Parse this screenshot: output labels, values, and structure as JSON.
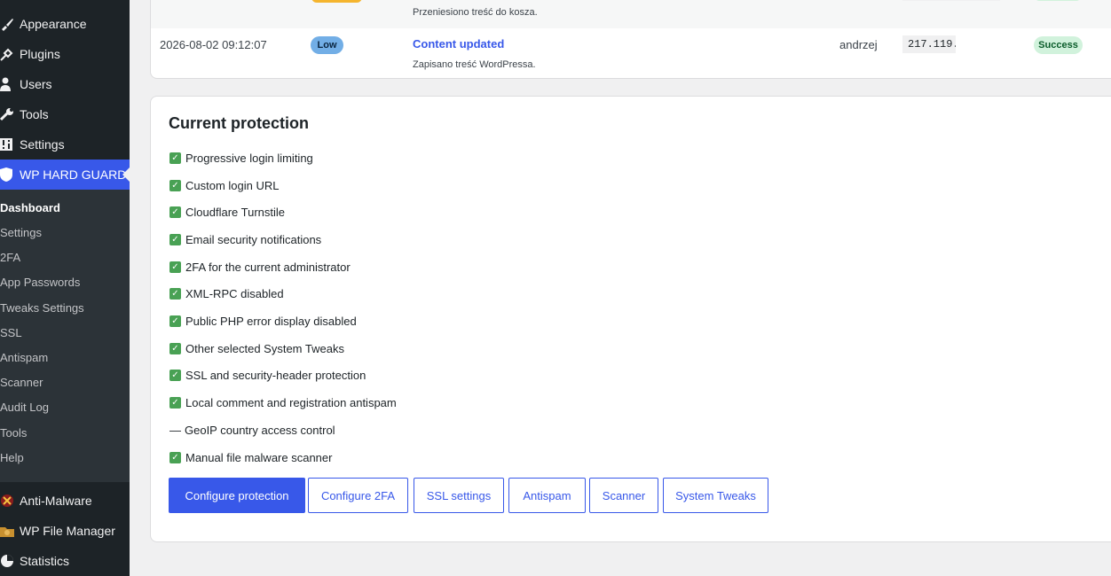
{
  "sidebar": {
    "items": [
      {
        "label": "Appearance",
        "icon": "paintbrush-icon"
      },
      {
        "label": "Plugins",
        "icon": "plug-icon"
      },
      {
        "label": "Users",
        "icon": "user-icon"
      },
      {
        "label": "Tools",
        "icon": "wrench-icon"
      },
      {
        "label": "Settings",
        "icon": "sliders-icon"
      },
      {
        "label": "WP HARD GUARD",
        "icon": "shield-icon"
      }
    ],
    "submenu": [
      "Dashboard",
      "Settings",
      "2FA",
      "App Passwords",
      "Tweaks Settings",
      "SSL",
      "Antispam",
      "Scanner",
      "Audit Log",
      "Tools",
      "Help"
    ],
    "bottom_items": [
      {
        "label": "Anti-Malware",
        "icon": "malware-icon"
      },
      {
        "label": "WP File Manager",
        "icon": "folder-icon"
      },
      {
        "label": "Statistics",
        "icon": "chart-pie-icon"
      }
    ]
  },
  "log": {
    "prev_row_detail": "Przeniesiono treść do kosza.",
    "row": {
      "timestamp": "2026-08-02 09:12:07",
      "severity": "Low",
      "event": "Content updated",
      "detail": "Zapisano treść WordPressa.",
      "user": "andrzej",
      "ip": "217.119.",
      "status": "Success"
    }
  },
  "protection": {
    "title": "Current protection",
    "items": [
      {
        "label": "Progressive login limiting",
        "enabled": true
      },
      {
        "label": "Custom login URL",
        "enabled": true
      },
      {
        "label": "Cloudflare Turnstile",
        "enabled": true
      },
      {
        "label": "Email security notifications",
        "enabled": true
      },
      {
        "label": "2FA for the current administrator",
        "enabled": true
      },
      {
        "label": "XML-RPC disabled",
        "enabled": true
      },
      {
        "label": "Public PHP error display disabled",
        "enabled": true
      },
      {
        "label": "Other selected System Tweaks",
        "enabled": true
      },
      {
        "label": "SSL and security-header protection",
        "enabled": true
      },
      {
        "label": "Local comment and registration antispam",
        "enabled": true
      },
      {
        "label": "GeoIP country access control",
        "enabled": false
      },
      {
        "label": "Manual file malware scanner",
        "enabled": true
      }
    ],
    "enabled_mark": "✓",
    "disabled_mark": "—",
    "buttons": [
      "Configure protection",
      "Configure 2FA",
      "SSL settings",
      "Antispam",
      "Scanner",
      "System Tweaks"
    ]
  },
  "colors": {
    "accent": "#3858e9",
    "sidebar_bg": "#1d2327",
    "check_green": "#49a154",
    "success_bg": "#d1f2dc",
    "low_badge": "#72aee6"
  }
}
